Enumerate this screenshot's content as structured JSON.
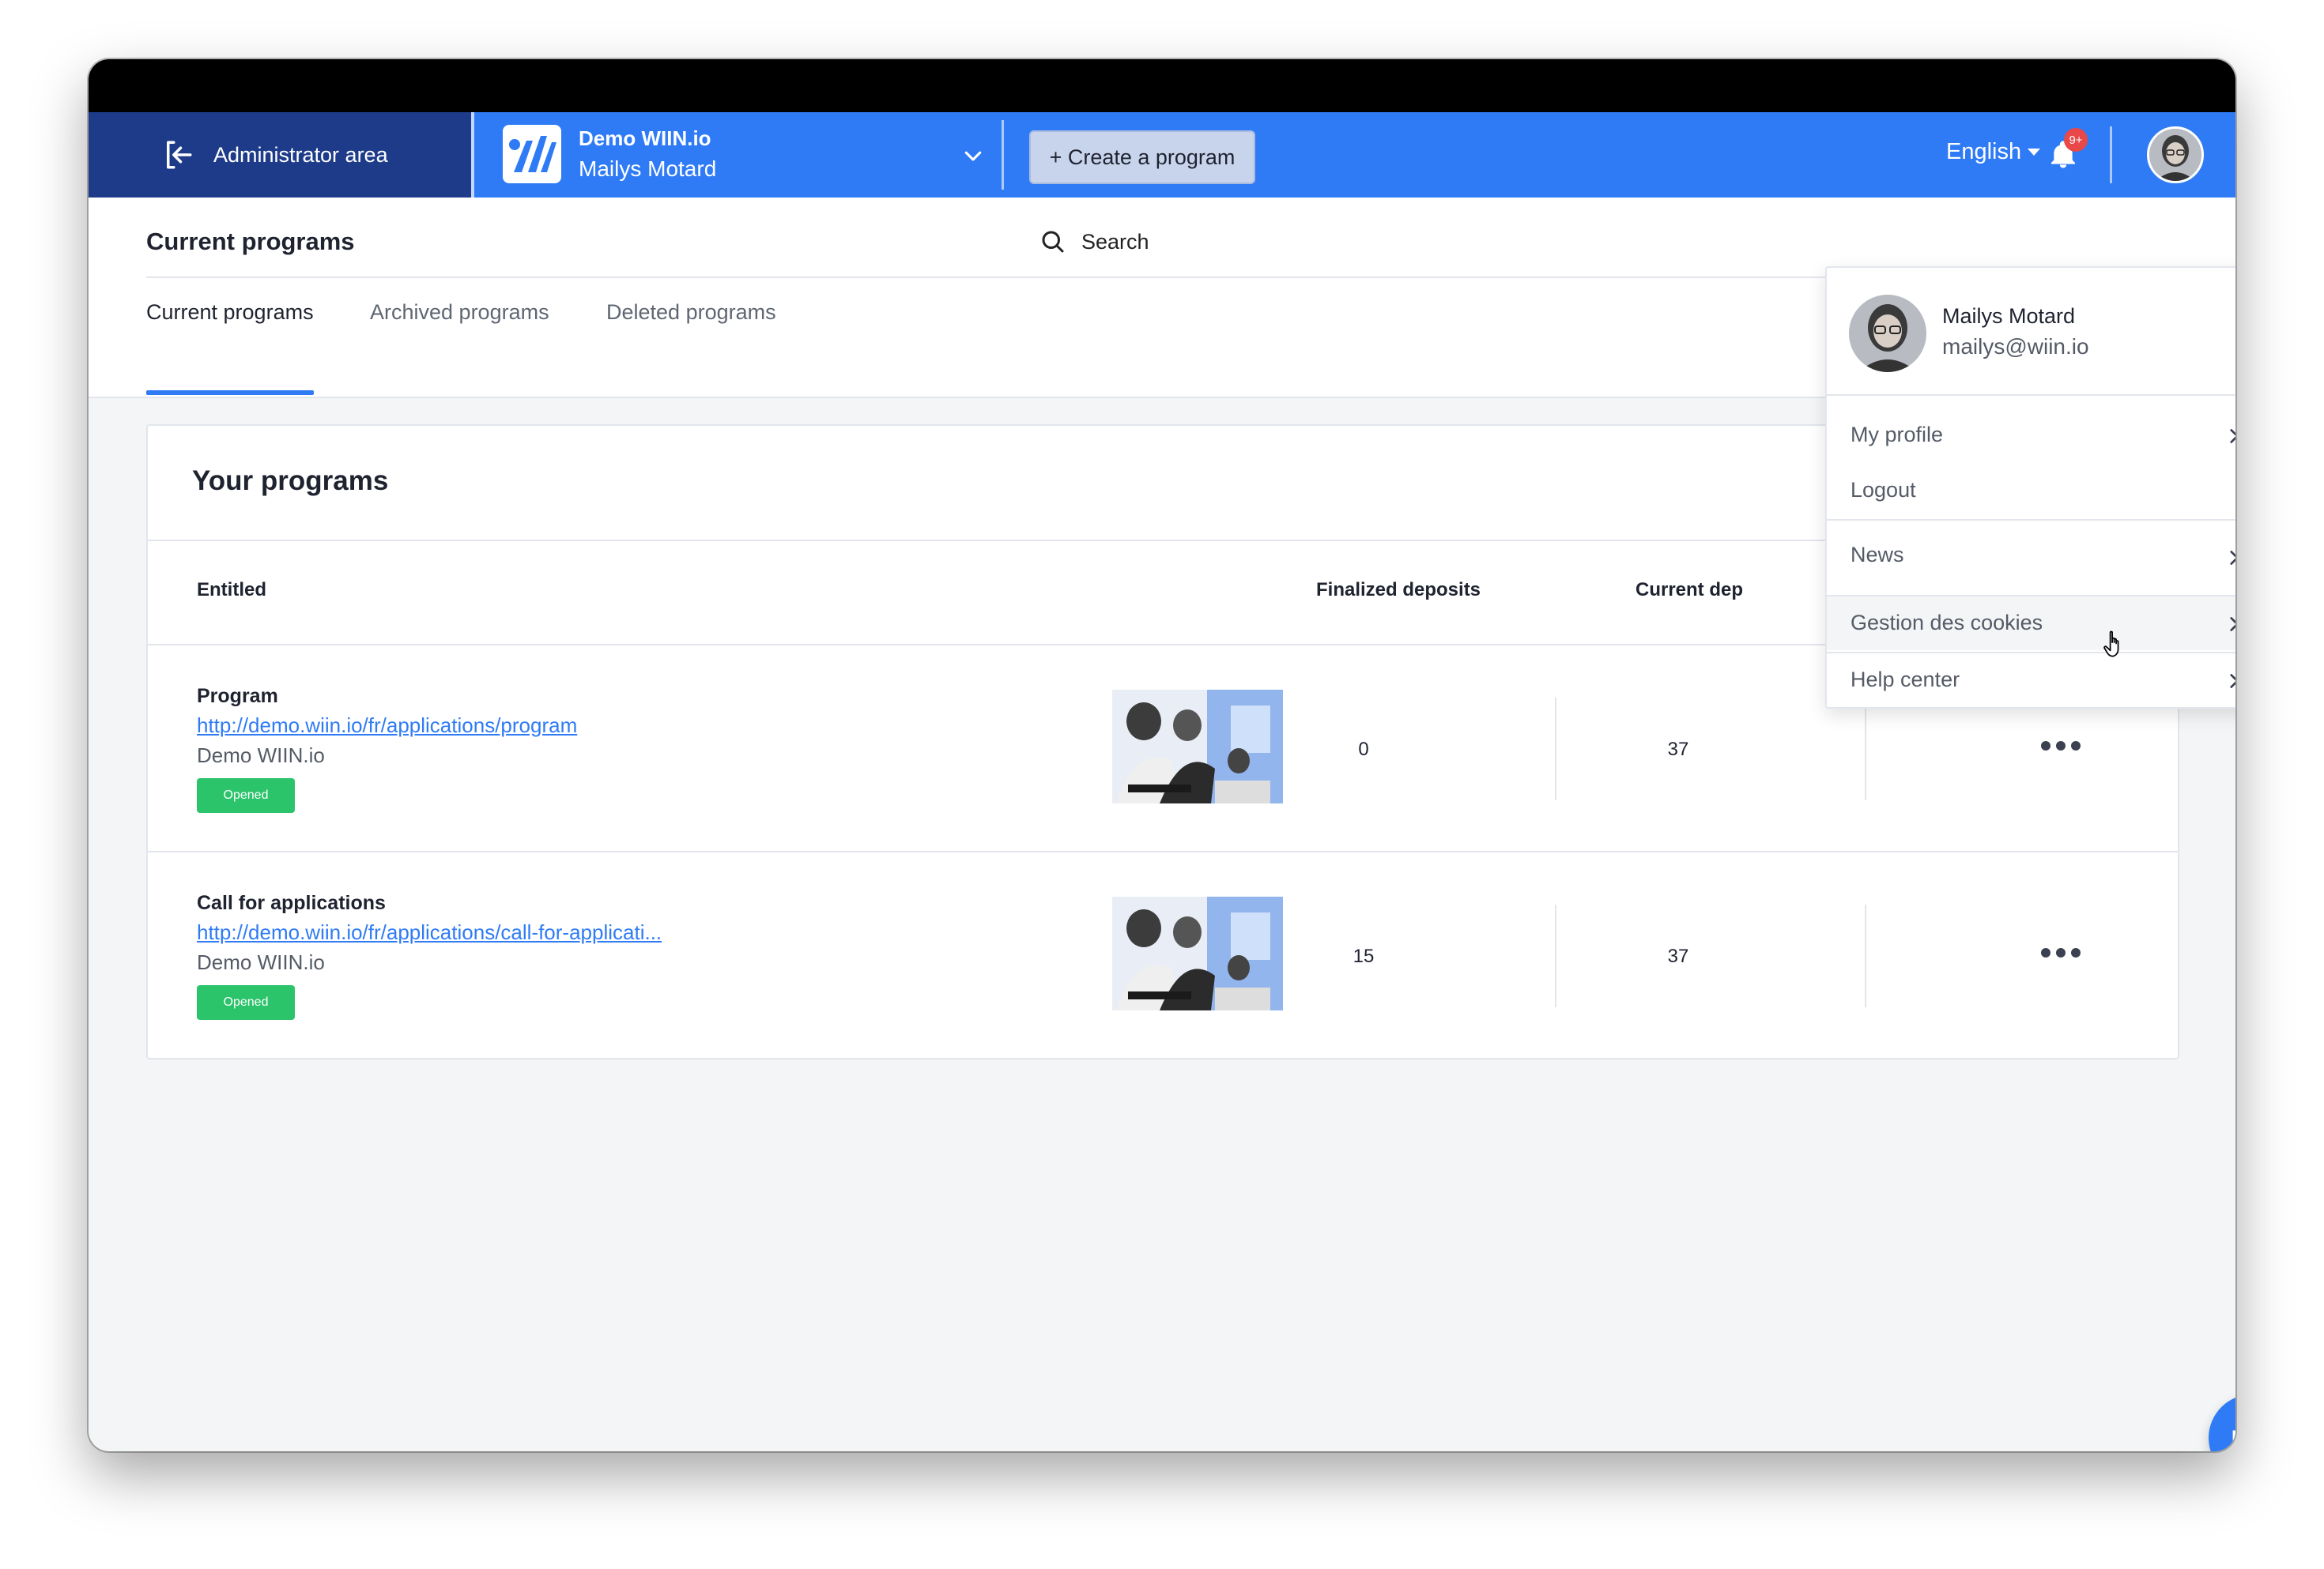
{
  "nav": {
    "admin_label": "Administrator area",
    "org_name": "Demo WIIN.io",
    "org_user": "Mailys Motard",
    "create_label": "+ Create a program",
    "language": "English",
    "notif_badge": "9+"
  },
  "header": {
    "title": "Current programs",
    "search_label": "Search",
    "tabs": [
      {
        "label": "Current programs",
        "active": true
      },
      {
        "label": "Archived programs",
        "active": false
      },
      {
        "label": "Deleted programs",
        "active": false
      }
    ]
  },
  "card": {
    "title": "Your programs",
    "columns": {
      "entitled": "Entitled",
      "finalized": "Finalized deposits",
      "current": "Current dep"
    },
    "rows": [
      {
        "name": "Program",
        "link": "http://demo.wiin.io/fr/applications/program",
        "org": "Demo WIIN.io",
        "status": "Opened",
        "finalized": "0",
        "current": "37"
      },
      {
        "name": "Call for applications",
        "link": "http://demo.wiin.io/fr/applications/call-for-applicati...",
        "org": "Demo WIIN.io",
        "status": "Opened",
        "finalized": "15",
        "current": "37"
      }
    ]
  },
  "user_menu": {
    "name": "Mailys Motard",
    "email": "mailys@wiin.io",
    "items": [
      {
        "label": "My profile"
      },
      {
        "label": "Logout"
      },
      {
        "label": "News"
      },
      {
        "label": "Gestion des cookies"
      },
      {
        "label": "Help center"
      }
    ]
  },
  "help_label": "Help",
  "colors": {
    "primary": "#2f7bf5",
    "admin_bg": "#1e3b8a",
    "status_green": "#2bc46b",
    "badge_red": "#e94848"
  }
}
